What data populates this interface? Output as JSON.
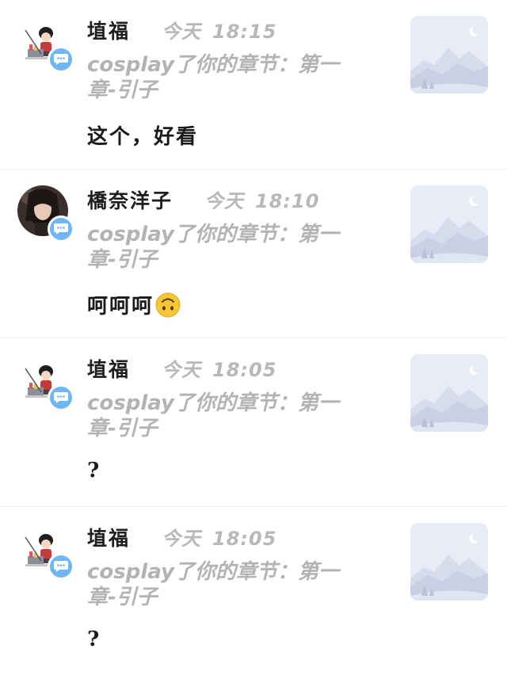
{
  "colors": {
    "username": "#1f1f1f",
    "time": "#b8b8b8",
    "activity": "#b3b3b3",
    "comment": "#1a1a1a",
    "badge": "#6fb7f4",
    "thumb_bg": "#e8ecf7",
    "divider": "#eeeeee"
  },
  "items": [
    {
      "username": "埴福",
      "time_label": "今天",
      "time": "18:15",
      "activity_line1": "cosplay了你的章节：第一",
      "activity_line2": "章-引子",
      "comment": "这个，好看",
      "avatar_icon": "kid-illustration-avatar",
      "badge_icon": "chat-bubble-icon",
      "thumb_icon": "mountain-placeholder-icon"
    },
    {
      "username": "橋奈洋子",
      "time_label": "今天",
      "time": "18:10",
      "activity_line1": "cosplay了你的章节：第一",
      "activity_line2": "章-引子",
      "comment": "呵呵呵",
      "comment_emoji": "upside-down-face-emoji",
      "avatar_icon": "girl-photo-avatar",
      "badge_icon": "chat-bubble-icon",
      "thumb_icon": "mountain-placeholder-icon"
    },
    {
      "username": "埴福",
      "time_label": "今天",
      "time": "18:05",
      "activity_line1": "cosplay了你的章节：第一",
      "activity_line2": "章-引子",
      "comment": "?",
      "avatar_icon": "kid-illustration-avatar",
      "badge_icon": "chat-bubble-icon",
      "thumb_icon": "mountain-placeholder-icon"
    },
    {
      "username": "埴福",
      "time_label": "今天",
      "time": "18:05",
      "activity_line1": "cosplay了你的章节：第一",
      "activity_line2": "章-引子",
      "comment": "?",
      "avatar_icon": "kid-illustration-avatar",
      "badge_icon": "chat-bubble-icon",
      "thumb_icon": "mountain-placeholder-icon"
    }
  ]
}
